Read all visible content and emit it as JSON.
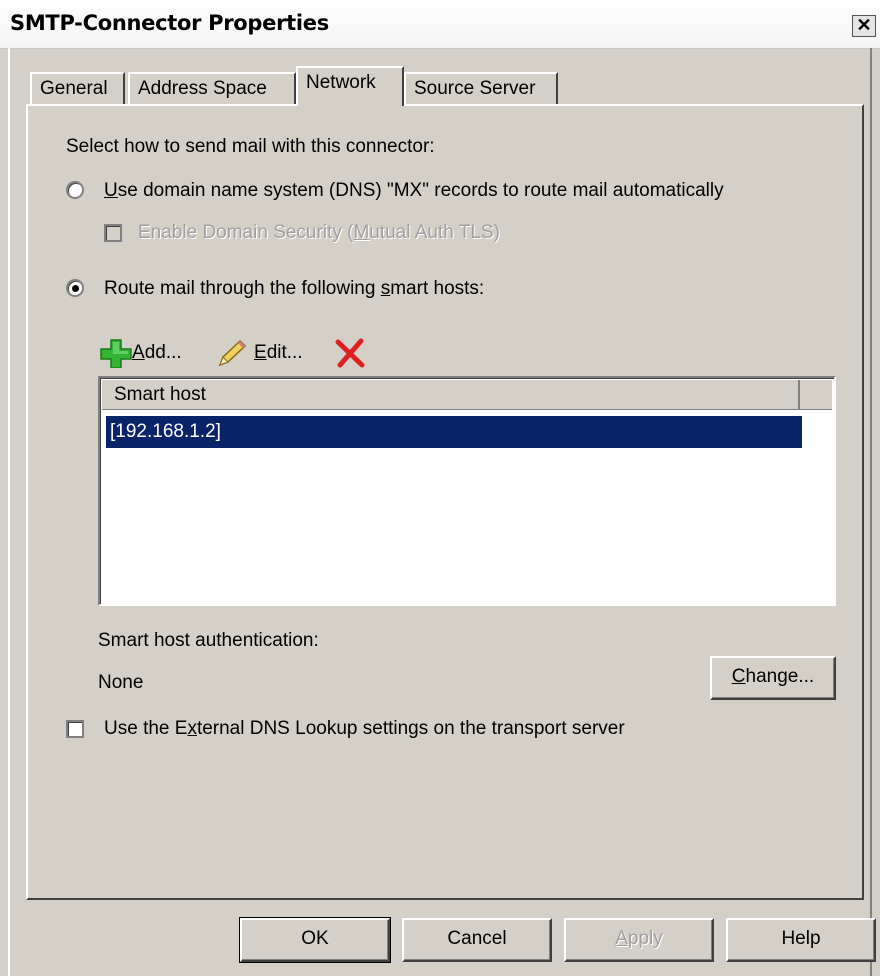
{
  "window": {
    "title": "SMTP-Connector Properties",
    "close_glyph": "✕"
  },
  "tabs": [
    {
      "label": "General",
      "active": false
    },
    {
      "label": "Address Space",
      "active": false
    },
    {
      "label": "Network",
      "active": true
    },
    {
      "label": "Source Server",
      "active": false
    }
  ],
  "network": {
    "prompt": "Select how to send mail with this connector:",
    "dns_option": {
      "label_prefix": "",
      "label_underline": "U",
      "label_rest": "se domain name system (DNS) \"MX\" records to route mail automatically",
      "selected": false
    },
    "domain_security": {
      "label_before": "Enable Domain Security (",
      "label_underline": "M",
      "label_after": "utual Auth TLS)",
      "checked": false,
      "enabled": false
    },
    "smart_host_option": {
      "label_before": "Route mail through the following ",
      "label_underline": "s",
      "label_after": "mart hosts:",
      "selected": true
    },
    "toolbar": {
      "add_underline": "A",
      "add_rest": "dd...",
      "edit_underline": "E",
      "edit_rest": "dit...",
      "icons": {
        "add": "plus-icon",
        "edit": "pencil-icon",
        "delete": "delete-x-icon"
      },
      "colors": {
        "add": "#33b533",
        "edit": "#c8a020",
        "delete": "#e02020"
      }
    },
    "smart_hosts": {
      "column_header": "Smart host",
      "rows": [
        "[192.168.1.2]"
      ],
      "selected_index": 0
    },
    "auth": {
      "label": "Smart host authentication:",
      "value": "None",
      "change_underline": "C",
      "change_rest": "hange..."
    },
    "external_dns": {
      "label_before": "Use the E",
      "label_underline": "x",
      "label_after": "ternal DNS Lookup settings on the transport server",
      "checked": false
    }
  },
  "buttons": {
    "ok": "OK",
    "cancel": "Cancel",
    "apply_underline": "A",
    "apply_rest": "pply",
    "help": "Help"
  },
  "colors": {
    "selection": "#0a246a",
    "dialog_bg": "#d4d0c8"
  }
}
